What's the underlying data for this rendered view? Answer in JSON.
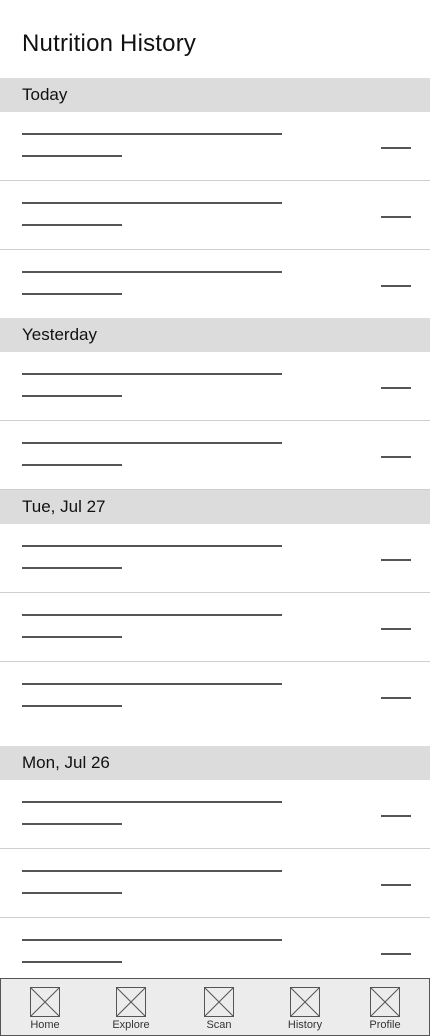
{
  "header": {
    "title": "Nutrition History"
  },
  "sections": [
    {
      "label": "Today",
      "rows": 3
    },
    {
      "label": "Yesterday",
      "rows": 2
    },
    {
      "label": "Tue, Jul 27",
      "rows": 3
    },
    {
      "label": "Mon, Jul 26",
      "rows": 3
    }
  ],
  "tabbar": {
    "tabs": [
      {
        "label": "Home",
        "icon": "placeholder-image-icon"
      },
      {
        "label": "Explore",
        "icon": "placeholder-image-icon"
      },
      {
        "label": "Scan",
        "icon": "placeholder-image-icon"
      },
      {
        "label": "History",
        "icon": "placeholder-image-icon"
      },
      {
        "label": "Profile",
        "icon": "placeholder-image-icon"
      }
    ]
  },
  "colors": {
    "section_bg": "#dcdcdc",
    "divider": "#cfcfcf",
    "placeholder_line": "#555555",
    "tabbar_bg": "#ececec"
  }
}
